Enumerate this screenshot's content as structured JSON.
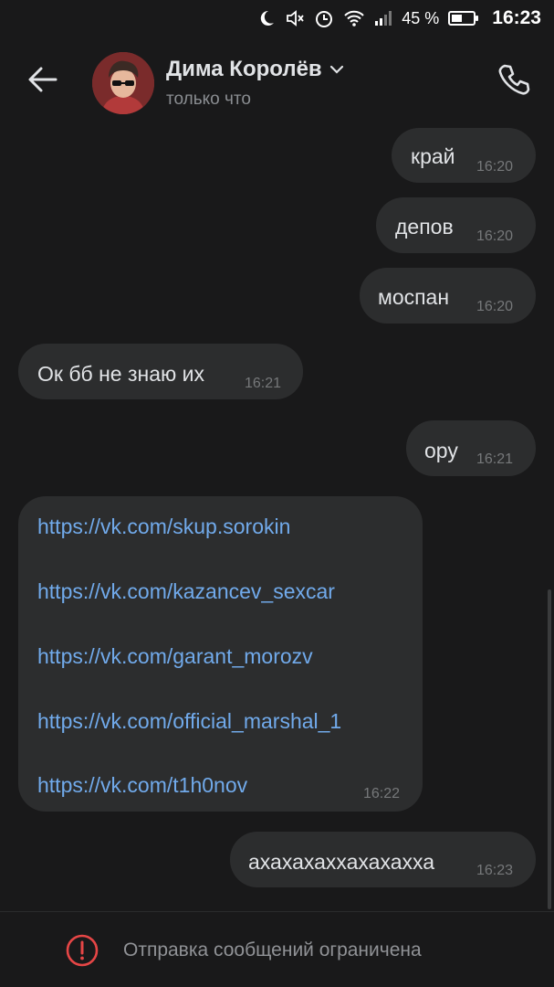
{
  "status_bar": {
    "battery_percent": "45 %",
    "clock": "16:23",
    "battery_level": 0.45
  },
  "header": {
    "contact_name": "Дима Королёв",
    "contact_status": "только что"
  },
  "messages": [
    {
      "text": "край",
      "time": "16:20",
      "outgoing": true
    },
    {
      "text": "депов",
      "time": "16:20",
      "outgoing": true
    },
    {
      "text": "моспан",
      "time": "16:20",
      "outgoing": true
    },
    {
      "text": "Ок бб не знаю их",
      "time": "16:21",
      "outgoing": false
    },
    {
      "text": "ору",
      "time": "16:21",
      "outgoing": true
    },
    {
      "links": [
        "https://vk.com/skup.sorokin",
        "https://vk.com/kazancev_sexcar",
        "https://vk.com/garant_morozv",
        "https://vk.com/official_marshal_1",
        "https://vk.com/t1h0nov"
      ],
      "time": "16:22",
      "outgoing": false
    },
    {
      "text": "ахахахаххахахахха",
      "time": "16:23",
      "outgoing": true
    }
  ],
  "bottom": {
    "restriction_text": "Отправка сообщений ограничена"
  },
  "colors": {
    "background": "#19191a",
    "bubble": "#2c2d2e",
    "link": "#71aaeb",
    "warning": "#e64646"
  }
}
